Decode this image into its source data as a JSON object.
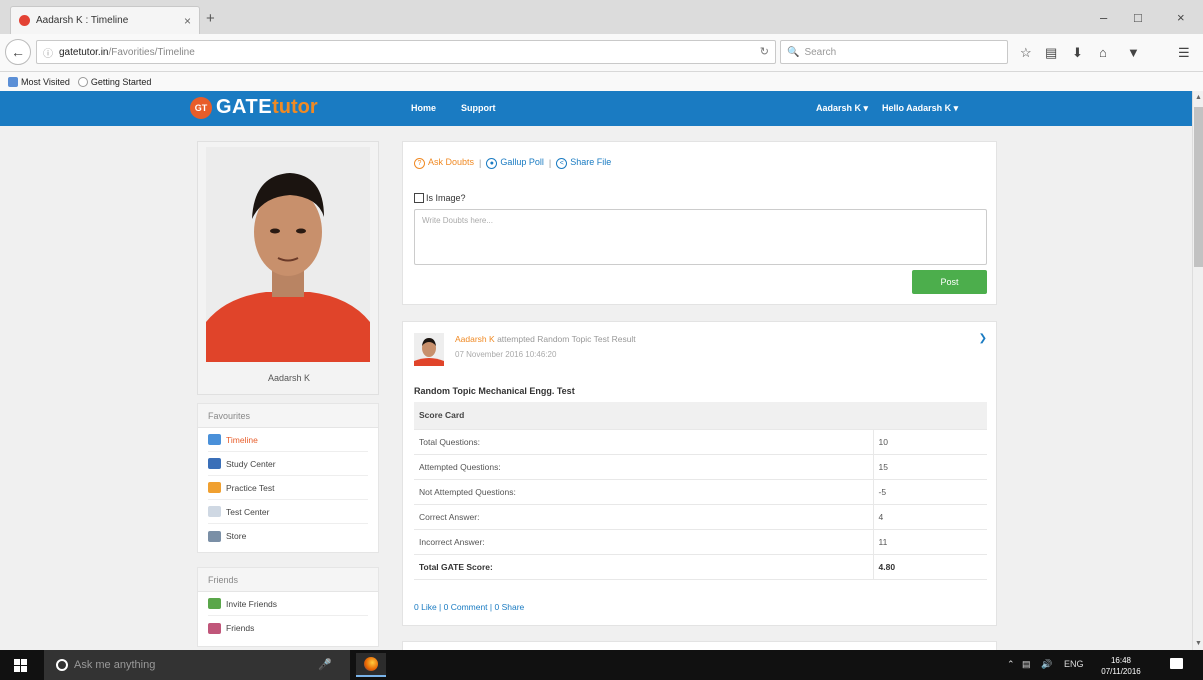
{
  "browser": {
    "tab_title": "Aadarsh K : Timeline",
    "tab_close": "×",
    "new_tab": "+",
    "url_host": "gatetutor.in",
    "url_path": "/Favorities/Timeline",
    "search_placeholder": "Search",
    "window_controls": [
      "–",
      "□",
      "×"
    ],
    "bookmarks": [
      "Most Visited",
      "Getting Started"
    ]
  },
  "site": {
    "logo_badge": "GT",
    "logo_text_1": "GATE",
    "logo_text_2": "tutor",
    "nav": [
      "Home",
      "Support"
    ],
    "user_menu_1": "Aadarsh K ▾",
    "user_menu_2": "Hello Aadarsh K ▾",
    "brand_color": "#1a7bc2",
    "accent_color": "#f08a24"
  },
  "profile": {
    "name": "Aadarsh K"
  },
  "favourites": {
    "heading": "Favourites",
    "items": [
      {
        "label": "Timeline",
        "icon": "timeline-icon",
        "active": true
      },
      {
        "label": "Study Center",
        "icon": "study-center-icon"
      },
      {
        "label": "Practice Test",
        "icon": "practice-test-icon"
      },
      {
        "label": "Test Center",
        "icon": "test-center-icon"
      },
      {
        "label": "Store",
        "icon": "store-icon"
      }
    ]
  },
  "friends": {
    "heading": "Friends",
    "items": [
      {
        "label": "Invite Friends",
        "icon": "invite-friends-icon"
      },
      {
        "label": "Friends",
        "icon": "friends-icon"
      }
    ]
  },
  "composer": {
    "ask_doubts": "Ask Doubts",
    "gallup_poll": "Gallup Poll",
    "share_file": "Share File",
    "separator": "|",
    "is_image_label": "Is Image?",
    "doubt_placeholder": "Write Doubts here...",
    "post_button": "Post"
  },
  "post": {
    "author": "Aadarsh K",
    "action": "attempted Random Topic Test Result",
    "date": "07 November 2016 10:46:20",
    "title": "Random Topic Mechanical Engg. Test",
    "score_card_heading": "Score Card",
    "rows": [
      {
        "label": "Total Questions:",
        "value": "10"
      },
      {
        "label": "Attempted Questions:",
        "value": "15"
      },
      {
        "label": "Not Attempted Questions:",
        "value": "-5"
      },
      {
        "label": "Correct Answer:",
        "value": "4"
      },
      {
        "label": "Incorrect Answer:",
        "value": "11"
      }
    ],
    "total_label": "Total GATE Score:",
    "total_value": "4.80",
    "footer": "0 Like | 0 Comment | 0 Share"
  },
  "taskbar": {
    "search_placeholder": "Ask me anything",
    "language": "ENG",
    "time": "16:48",
    "date": "07/11/2016"
  }
}
